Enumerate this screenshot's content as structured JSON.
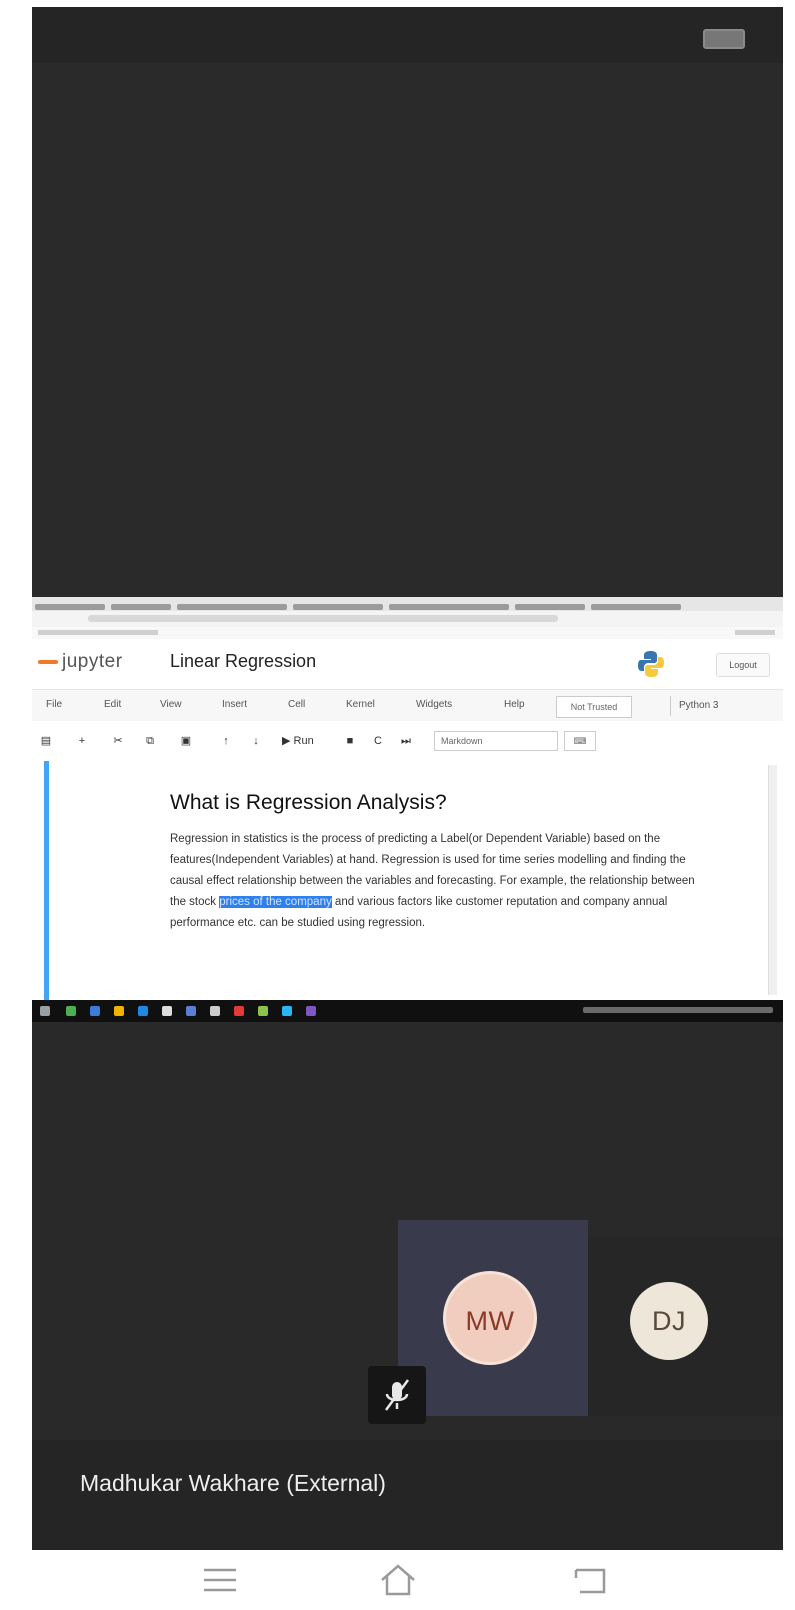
{
  "video_top": {
    "cc_icon": "closed-captions-icon"
  },
  "shared_screen": {
    "notebook": {
      "logo_text": "jupyter",
      "title": "Linear Regression",
      "python_icon": "python-logo-icon",
      "logout_label": "Logout",
      "menu": [
        "File",
        "Edit",
        "View",
        "Insert",
        "Cell",
        "Kernel",
        "Widgets",
        "Help"
      ],
      "trusted_label": "Not Trusted",
      "kernel_label": "Python 3",
      "toolbar": {
        "run_label": "Run",
        "cell_type": "Markdown",
        "keyboard_label": "⌨"
      },
      "cell": {
        "heading": "What is Regression Analysis?",
        "paragraph_before": "Regression in statistics is the process of predicting a Label(or Dependent Variable) based on the features(Independent Variables) at hand. Regression is used for time series modelling and finding the causal effect relationship between the variables and forecasting. For example, the relationship between the stock ",
        "paragraph_highlight": "prices of the company",
        "paragraph_after": " and various factors like customer reputation and company annual performance etc. can be studied using regression."
      }
    }
  },
  "participants": [
    {
      "initials": "MW",
      "color": "#f1cdbf"
    },
    {
      "initials": "DJ",
      "color": "#efe6da"
    }
  ],
  "active_speaker": {
    "name": "Madhukar Wakhare (External)",
    "mic_icon": "microphone-muted-icon"
  },
  "android_nav": {
    "menu_icon": "menu-icon",
    "home_icon": "home-icon",
    "back_icon": "back-icon"
  }
}
